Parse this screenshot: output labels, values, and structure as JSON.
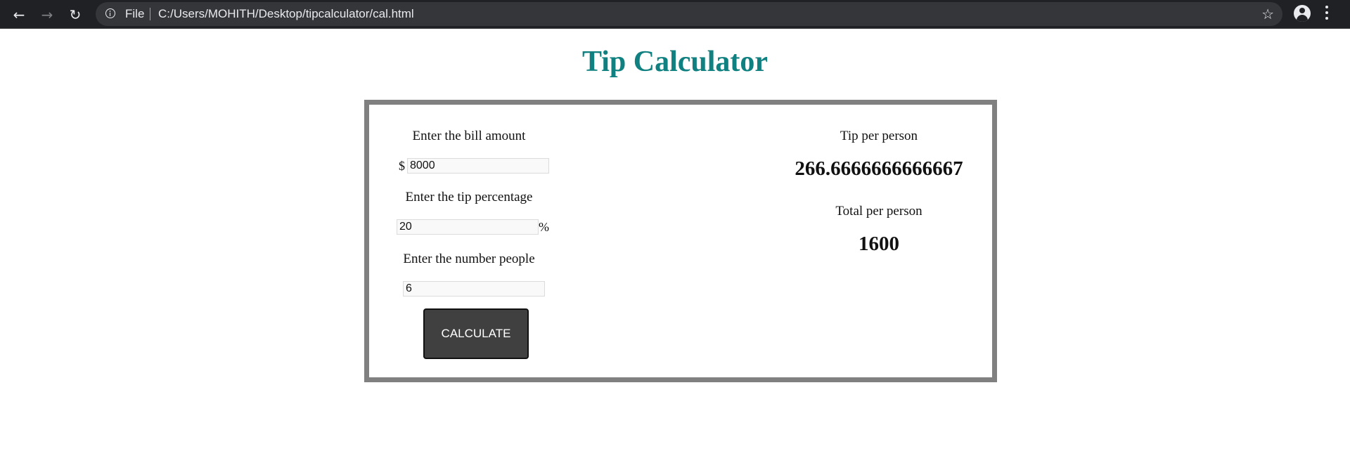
{
  "browser": {
    "scheme_label": "File",
    "url": "C:/Users/MOHITH/Desktop/tipcalculator/cal.html"
  },
  "page": {
    "title": "Tip Calculator"
  },
  "calculator": {
    "bill": {
      "label": "Enter the bill amount",
      "prefix": "$",
      "value": "8000"
    },
    "tip": {
      "label": "Enter the tip percentage",
      "suffix": "%",
      "value": "20"
    },
    "people": {
      "label": "Enter the number people",
      "value": "6"
    },
    "button_label": "CALCULATE"
  },
  "results": {
    "tip_label": "Tip per person",
    "tip_value": "266.6666666666667",
    "total_label": "Total per person",
    "total_value": "1600"
  },
  "colors": {
    "title": "#108080",
    "border": "#808080",
    "button": "#404040",
    "chrome": "#202124"
  }
}
